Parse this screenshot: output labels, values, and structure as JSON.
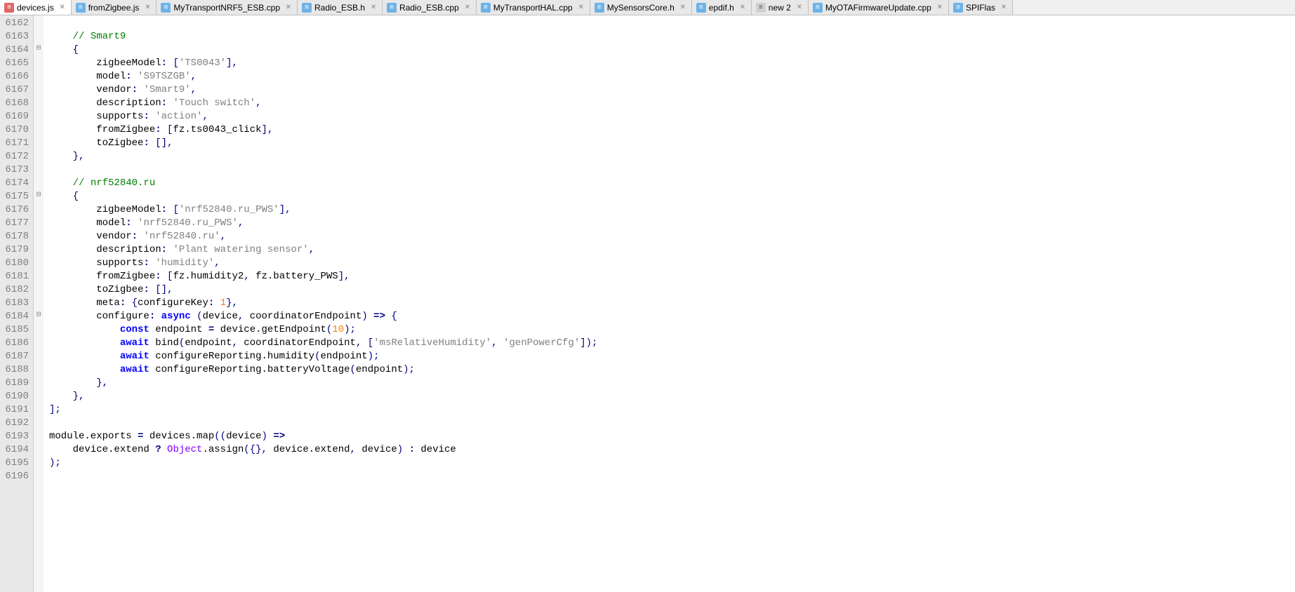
{
  "tabs": [
    {
      "label": "devices.js",
      "state": "unsaved",
      "active": true
    },
    {
      "label": "fromZigbee.js",
      "state": "saved",
      "active": false
    },
    {
      "label": "MyTransportNRF5_ESB.cpp",
      "state": "saved",
      "active": false
    },
    {
      "label": "Radio_ESB.h",
      "state": "saved",
      "active": false
    },
    {
      "label": "Radio_ESB.cpp",
      "state": "saved",
      "active": false
    },
    {
      "label": "MyTransportHAL.cpp",
      "state": "saved",
      "active": false
    },
    {
      "label": "MySensorsCore.h",
      "state": "saved",
      "active": false
    },
    {
      "label": "epdif.h",
      "state": "saved",
      "active": false
    },
    {
      "label": "new 2",
      "state": "new",
      "active": false
    },
    {
      "label": "MyOTAFirmwareUpdate.cpp",
      "state": "saved",
      "active": false
    },
    {
      "label": "SPIFlas",
      "state": "saved",
      "active": false
    }
  ],
  "line_start": 6162,
  "line_end": 6196,
  "fold_marks": {
    "6164": "⊟",
    "6175": "⊟",
    "6184": "⊟"
  },
  "code": {
    "6162": [],
    "6163": [
      [
        "sp",
        "    "
      ],
      [
        "tk-comment",
        "// Smart9"
      ]
    ],
    "6164": [
      [
        "sp",
        "    "
      ],
      [
        "tk-punc",
        "{"
      ]
    ],
    "6165": [
      [
        "sp",
        "        "
      ],
      [
        "tk-key",
        "zigbeeModel"
      ],
      [
        "tk-op",
        ":"
      ],
      [
        "sp",
        " "
      ],
      [
        "tk-punc",
        "["
      ],
      [
        "tk-str",
        "'TS0043'"
      ],
      [
        "tk-punc",
        "]"
      ],
      [
        "tk-punc",
        ","
      ]
    ],
    "6166": [
      [
        "sp",
        "        "
      ],
      [
        "tk-key",
        "model"
      ],
      [
        "tk-op",
        ":"
      ],
      [
        "sp",
        " "
      ],
      [
        "tk-str",
        "'S9TSZGB'"
      ],
      [
        "tk-punc",
        ","
      ]
    ],
    "6167": [
      [
        "sp",
        "        "
      ],
      [
        "tk-key",
        "vendor"
      ],
      [
        "tk-op",
        ":"
      ],
      [
        "sp",
        " "
      ],
      [
        "tk-str",
        "'Smart9'"
      ],
      [
        "tk-punc",
        ","
      ]
    ],
    "6168": [
      [
        "sp",
        "        "
      ],
      [
        "tk-key",
        "description"
      ],
      [
        "tk-op",
        ":"
      ],
      [
        "sp",
        " "
      ],
      [
        "tk-str",
        "'Touch switch'"
      ],
      [
        "tk-punc",
        ","
      ]
    ],
    "6169": [
      [
        "sp",
        "        "
      ],
      [
        "tk-key",
        "supports"
      ],
      [
        "tk-op",
        ":"
      ],
      [
        "sp",
        " "
      ],
      [
        "tk-str",
        "'action'"
      ],
      [
        "tk-punc",
        ","
      ]
    ],
    "6170": [
      [
        "sp",
        "        "
      ],
      [
        "tk-key",
        "fromZigbee"
      ],
      [
        "tk-op",
        ":"
      ],
      [
        "sp",
        " "
      ],
      [
        "tk-punc",
        "["
      ],
      [
        "tk-ident",
        "fz.ts0043_click"
      ],
      [
        "tk-punc",
        "]"
      ],
      [
        "tk-punc",
        ","
      ]
    ],
    "6171": [
      [
        "sp",
        "        "
      ],
      [
        "tk-key",
        "toZigbee"
      ],
      [
        "tk-op",
        ":"
      ],
      [
        "sp",
        " "
      ],
      [
        "tk-punc",
        "["
      ],
      [
        "tk-punc",
        "]"
      ],
      [
        "tk-punc",
        ","
      ]
    ],
    "6172": [
      [
        "sp",
        "    "
      ],
      [
        "tk-punc",
        "}"
      ],
      [
        "tk-punc",
        ","
      ]
    ],
    "6173": [],
    "6174": [
      [
        "sp",
        "    "
      ],
      [
        "tk-comment",
        "// nrf52840.ru"
      ]
    ],
    "6175": [
      [
        "sp",
        "    "
      ],
      [
        "tk-punc",
        "{"
      ]
    ],
    "6176": [
      [
        "sp",
        "        "
      ],
      [
        "tk-key",
        "zigbeeModel"
      ],
      [
        "tk-op",
        ":"
      ],
      [
        "sp",
        " "
      ],
      [
        "tk-punc",
        "["
      ],
      [
        "tk-str",
        "'nrf52840.ru_PWS'"
      ],
      [
        "tk-punc",
        "]"
      ],
      [
        "tk-punc",
        ","
      ]
    ],
    "6177": [
      [
        "sp",
        "        "
      ],
      [
        "tk-key",
        "model"
      ],
      [
        "tk-op",
        ":"
      ],
      [
        "sp",
        " "
      ],
      [
        "tk-str",
        "'nrf52840.ru_PWS'"
      ],
      [
        "tk-punc",
        ","
      ]
    ],
    "6178": [
      [
        "sp",
        "        "
      ],
      [
        "tk-key",
        "vendor"
      ],
      [
        "tk-op",
        ":"
      ],
      [
        "sp",
        " "
      ],
      [
        "tk-str",
        "'nrf52840.ru'"
      ],
      [
        "tk-punc",
        ","
      ]
    ],
    "6179": [
      [
        "sp",
        "        "
      ],
      [
        "tk-key",
        "description"
      ],
      [
        "tk-op",
        ":"
      ],
      [
        "sp",
        " "
      ],
      [
        "tk-str",
        "'Plant watering sensor'"
      ],
      [
        "tk-punc",
        ","
      ]
    ],
    "6180": [
      [
        "sp",
        "        "
      ],
      [
        "tk-key",
        "supports"
      ],
      [
        "tk-op",
        ":"
      ],
      [
        "sp",
        " "
      ],
      [
        "tk-str",
        "'humidity'"
      ],
      [
        "tk-punc",
        ","
      ]
    ],
    "6181": [
      [
        "sp",
        "        "
      ],
      [
        "tk-key",
        "fromZigbee"
      ],
      [
        "tk-op",
        ":"
      ],
      [
        "sp",
        " "
      ],
      [
        "tk-punc",
        "["
      ],
      [
        "tk-ident",
        "fz.humidity2"
      ],
      [
        "tk-punc",
        ","
      ],
      [
        "sp",
        " "
      ],
      [
        "tk-ident",
        "fz.battery_PWS"
      ],
      [
        "tk-punc",
        "]"
      ],
      [
        "tk-punc",
        ","
      ]
    ],
    "6182": [
      [
        "sp",
        "        "
      ],
      [
        "tk-key",
        "toZigbee"
      ],
      [
        "tk-op",
        ":"
      ],
      [
        "sp",
        " "
      ],
      [
        "tk-punc",
        "["
      ],
      [
        "tk-punc",
        "]"
      ],
      [
        "tk-punc",
        ","
      ]
    ],
    "6183": [
      [
        "sp",
        "        "
      ],
      [
        "tk-key",
        "meta"
      ],
      [
        "tk-op",
        ":"
      ],
      [
        "sp",
        " "
      ],
      [
        "tk-punc",
        "{"
      ],
      [
        "tk-key",
        "configureKey"
      ],
      [
        "tk-op",
        ":"
      ],
      [
        "sp",
        " "
      ],
      [
        "tk-num",
        "1"
      ],
      [
        "tk-punc",
        "}"
      ],
      [
        "tk-punc",
        ","
      ]
    ],
    "6184": [
      [
        "sp",
        "        "
      ],
      [
        "tk-key",
        "configure"
      ],
      [
        "tk-op",
        ":"
      ],
      [
        "sp",
        " "
      ],
      [
        "tk-kw",
        "async"
      ],
      [
        "sp",
        " "
      ],
      [
        "tk-punc",
        "("
      ],
      [
        "tk-ident",
        "device"
      ],
      [
        "tk-punc",
        ","
      ],
      [
        "sp",
        " "
      ],
      [
        "tk-ident",
        "coordinatorEndpoint"
      ],
      [
        "tk-punc",
        ")"
      ],
      [
        "sp",
        " "
      ],
      [
        "tk-op",
        "=>"
      ],
      [
        "sp",
        " "
      ],
      [
        "tk-punc",
        "{"
      ]
    ],
    "6185": [
      [
        "sp",
        "            "
      ],
      [
        "tk-kw",
        "const"
      ],
      [
        "sp",
        " "
      ],
      [
        "tk-ident",
        "endpoint"
      ],
      [
        "sp",
        " "
      ],
      [
        "tk-op",
        "="
      ],
      [
        "sp",
        " "
      ],
      [
        "tk-ident",
        "device.getEndpoint"
      ],
      [
        "tk-punc",
        "("
      ],
      [
        "tk-num",
        "10"
      ],
      [
        "tk-punc",
        ")"
      ],
      [
        "tk-punc",
        ";"
      ]
    ],
    "6186": [
      [
        "sp",
        "            "
      ],
      [
        "tk-kw",
        "await"
      ],
      [
        "sp",
        " "
      ],
      [
        "tk-ident",
        "bind"
      ],
      [
        "tk-punc",
        "("
      ],
      [
        "tk-ident",
        "endpoint"
      ],
      [
        "tk-punc",
        ","
      ],
      [
        "sp",
        " "
      ],
      [
        "tk-ident",
        "coordinatorEndpoint"
      ],
      [
        "tk-punc",
        ","
      ],
      [
        "sp",
        " "
      ],
      [
        "tk-punc",
        "["
      ],
      [
        "tk-str",
        "'msRelativeHumidity'"
      ],
      [
        "tk-punc",
        ","
      ],
      [
        "sp",
        " "
      ],
      [
        "tk-str",
        "'genPowerCfg'"
      ],
      [
        "tk-punc",
        "]"
      ],
      [
        "tk-punc",
        ")"
      ],
      [
        "tk-punc",
        ";"
      ]
    ],
    "6187": [
      [
        "sp",
        "            "
      ],
      [
        "tk-kw",
        "await"
      ],
      [
        "sp",
        " "
      ],
      [
        "tk-ident",
        "configureReporting.humidity"
      ],
      [
        "tk-punc",
        "("
      ],
      [
        "tk-ident",
        "endpoint"
      ],
      [
        "tk-punc",
        ")"
      ],
      [
        "tk-punc",
        ";"
      ]
    ],
    "6188": [
      [
        "sp",
        "            "
      ],
      [
        "tk-kw",
        "await"
      ],
      [
        "sp",
        " "
      ],
      [
        "tk-ident",
        "configureReporting.batteryVoltage"
      ],
      [
        "tk-punc",
        "("
      ],
      [
        "tk-ident",
        "endpoint"
      ],
      [
        "tk-punc",
        ")"
      ],
      [
        "tk-punc",
        ";"
      ]
    ],
    "6189": [
      [
        "sp",
        "        "
      ],
      [
        "tk-punc",
        "}"
      ],
      [
        "tk-punc",
        ","
      ]
    ],
    "6190": [
      [
        "sp",
        "    "
      ],
      [
        "tk-punc",
        "}"
      ],
      [
        "tk-punc",
        ","
      ]
    ],
    "6191": [
      [
        "tk-punc",
        "]"
      ],
      [
        "tk-punc",
        ";"
      ]
    ],
    "6192": [],
    "6193": [
      [
        "tk-ident",
        "module.exports"
      ],
      [
        "sp",
        " "
      ],
      [
        "tk-op",
        "="
      ],
      [
        "sp",
        " "
      ],
      [
        "tk-ident",
        "devices.map"
      ],
      [
        "tk-punc",
        "("
      ],
      [
        "tk-punc",
        "("
      ],
      [
        "tk-ident",
        "device"
      ],
      [
        "tk-punc",
        ")"
      ],
      [
        "sp",
        " "
      ],
      [
        "tk-op",
        "=>"
      ]
    ],
    "6194": [
      [
        "sp",
        "    "
      ],
      [
        "tk-ident",
        "device.extend"
      ],
      [
        "sp",
        " "
      ],
      [
        "tk-op",
        "?"
      ],
      [
        "sp",
        " "
      ],
      [
        "tk-obj",
        "Object"
      ],
      [
        "tk-ident",
        ".assign"
      ],
      [
        "tk-punc",
        "("
      ],
      [
        "tk-punc",
        "{"
      ],
      [
        "tk-punc",
        "}"
      ],
      [
        "tk-punc",
        ","
      ],
      [
        "sp",
        " "
      ],
      [
        "tk-ident",
        "device.extend"
      ],
      [
        "tk-punc",
        ","
      ],
      [
        "sp",
        " "
      ],
      [
        "tk-ident",
        "device"
      ],
      [
        "tk-punc",
        ")"
      ],
      [
        "sp",
        " "
      ],
      [
        "tk-op",
        ":"
      ],
      [
        "sp",
        " "
      ],
      [
        "tk-ident",
        "device"
      ]
    ],
    "6195": [
      [
        "tk-punc",
        ")"
      ],
      [
        "tk-punc",
        ";"
      ]
    ],
    "6196": []
  }
}
